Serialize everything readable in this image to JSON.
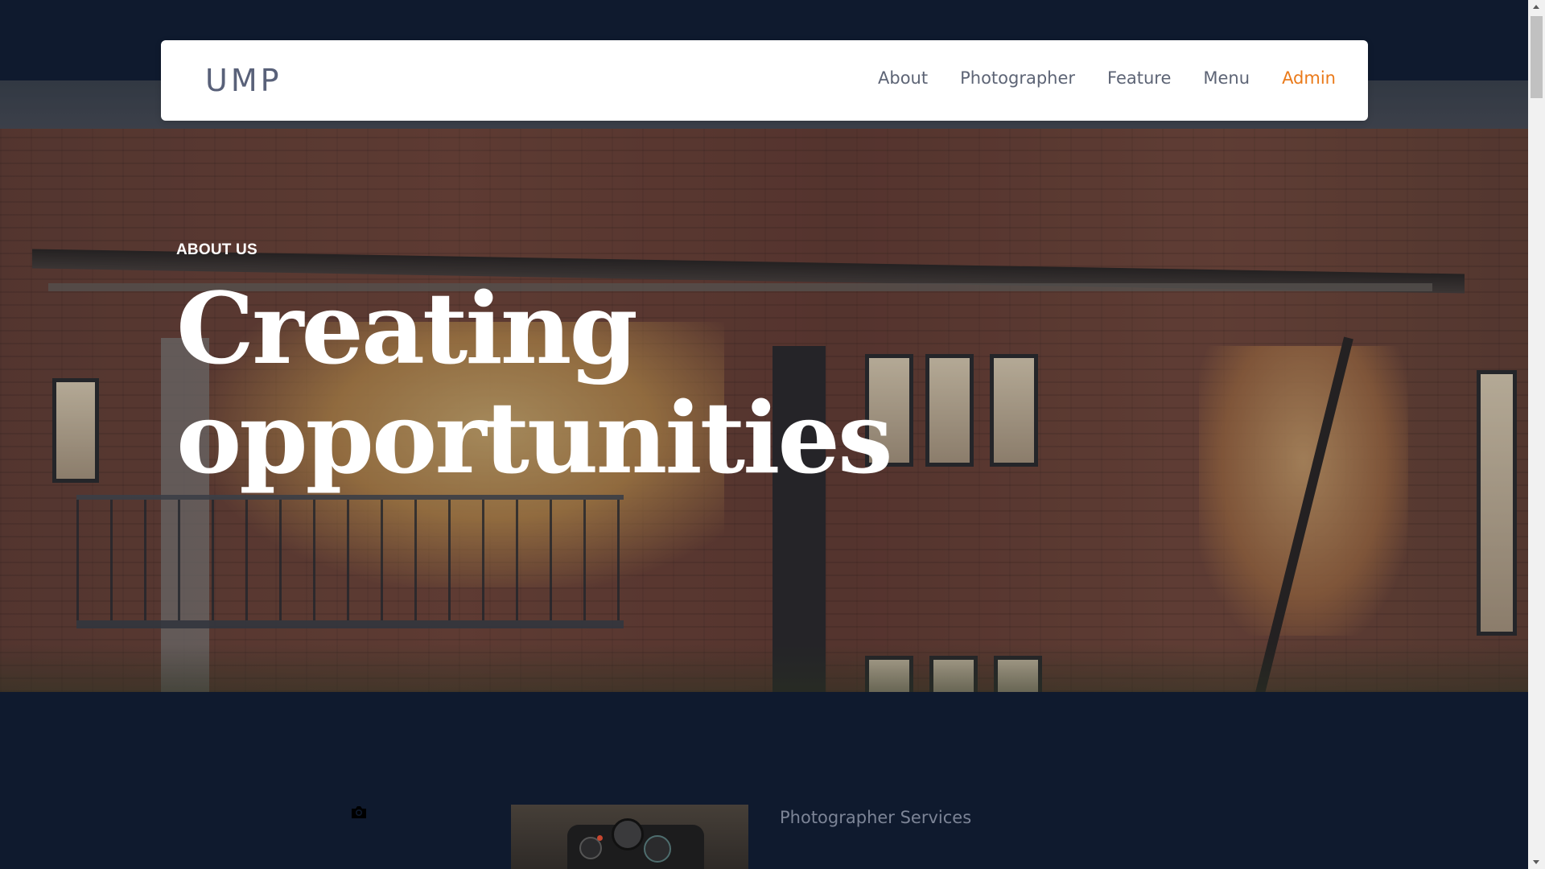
{
  "navbar": {
    "brand": "UMP",
    "links": [
      {
        "label": "About"
      },
      {
        "label": "Photographer"
      },
      {
        "label": "Feature"
      },
      {
        "label": "Menu"
      },
      {
        "label": "Admin",
        "active": true
      }
    ]
  },
  "hero": {
    "eyebrow": "ABOUT US",
    "headline_line1": "Creating",
    "headline_line2": "opportunities"
  },
  "services": {
    "title": "Photographer Services",
    "icon": "camera-icon"
  },
  "colors": {
    "page_bg": "#0f1a2e",
    "nav_text": "#5d6475",
    "nav_active": "#ea7a1a",
    "brand_text": "#596179",
    "section_title": "#7c8496"
  }
}
